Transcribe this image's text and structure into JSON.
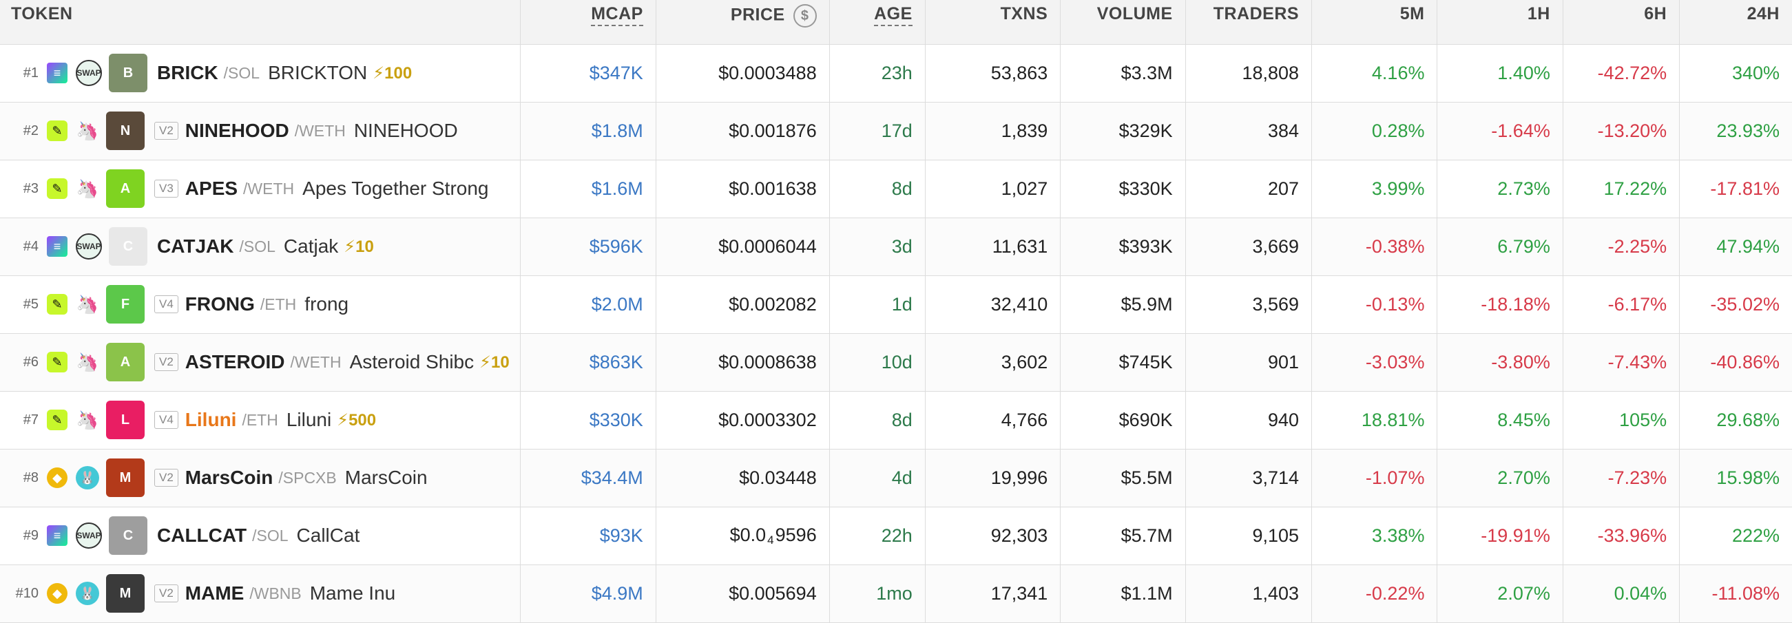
{
  "header": {
    "token": "TOKEN",
    "mcap": "MCAP",
    "price": "PRICE",
    "price_icon": "$",
    "age": "AGE",
    "txns": "TXNS",
    "volume": "VOLUME",
    "traders": "TRADERS",
    "m5": "5M",
    "h1": "1H",
    "h6": "6H",
    "h24": "24H"
  },
  "colors": {
    "positive": "#2ea043",
    "negative": "#d73a49",
    "mcap_blue": "#3b78c4",
    "age_green": "#2d7a4b",
    "boost_gold": "#c9a010"
  },
  "rows": [
    {
      "rank": "#1",
      "chain_icon": "solana-icon",
      "chain_glyph": "≡",
      "dex_icon": "raydium-swap-icon",
      "dex_glyph": "SWAP",
      "avatar_icon": "brick-avatar",
      "avatar_color": "#7d8f6a",
      "avatar_glyph": "B",
      "version": "",
      "symbol": "BRICK",
      "pair": "/SOL",
      "name": "BRICKTON",
      "boost": "⚡100",
      "mcap": "$347K",
      "price": "$0.0003488",
      "age": "23h",
      "txns": "53,863",
      "volume": "$3.3M",
      "traders": "18,808",
      "m5": "4.16%",
      "h1": "1.40%",
      "h6": "-42.72%",
      "h24": "340%"
    },
    {
      "rank": "#2",
      "chain_icon": "base-icon",
      "chain_glyph": "✎",
      "dex_icon": "uniswap-icon",
      "dex_glyph": "🦄",
      "avatar_icon": "ninehood-avatar",
      "avatar_color": "#5a4a3a",
      "avatar_glyph": "N",
      "version": "V2",
      "symbol": "NINEHOOD",
      "pair": "/WETH",
      "name": "NINEHOOD",
      "boost": "",
      "mcap": "$1.8M",
      "price": "$0.001876",
      "age": "17d",
      "txns": "1,839",
      "volume": "$329K",
      "traders": "384",
      "m5": "0.28%",
      "h1": "-1.64%",
      "h6": "-13.20%",
      "h24": "23.93%"
    },
    {
      "rank": "#3",
      "chain_icon": "base-icon",
      "chain_glyph": "✎",
      "dex_icon": "uniswap-icon",
      "dex_glyph": "🦄",
      "avatar_icon": "apes-avatar",
      "avatar_color": "#7fd321",
      "avatar_glyph": "A",
      "version": "V3",
      "symbol": "APES",
      "pair": "/WETH",
      "name": "Apes Together Strong",
      "boost": "",
      "mcap": "$1.6M",
      "price": "$0.001638",
      "age": "8d",
      "txns": "1,027",
      "volume": "$330K",
      "traders": "207",
      "m5": "3.99%",
      "h1": "2.73%",
      "h6": "17.22%",
      "h24": "-17.81%"
    },
    {
      "rank": "#4",
      "chain_icon": "solana-icon",
      "chain_glyph": "≡",
      "dex_icon": "raydium-swap-icon",
      "dex_glyph": "SWAP",
      "avatar_icon": "catjak-avatar",
      "avatar_color": "#e8e8e8",
      "avatar_glyph": "C",
      "version": "",
      "symbol": "CATJAK",
      "pair": "/SOL",
      "name": "Catjak",
      "boost": "⚡10",
      "mcap": "$596K",
      "price": "$0.0006044",
      "age": "3d",
      "txns": "11,631",
      "volume": "$393K",
      "traders": "3,669",
      "m5": "-0.38%",
      "h1": "6.79%",
      "h6": "-2.25%",
      "h24": "47.94%"
    },
    {
      "rank": "#5",
      "chain_icon": "base-icon",
      "chain_glyph": "✎",
      "dex_icon": "uniswap-icon",
      "dex_glyph": "🦄",
      "avatar_icon": "frong-avatar",
      "avatar_color": "#5cc84a",
      "avatar_glyph": "F",
      "version": "V4",
      "symbol": "FRONG",
      "pair": "/ETH",
      "name": "frong",
      "boost": "",
      "mcap": "$2.0M",
      "price": "$0.002082",
      "age": "1d",
      "txns": "32,410",
      "volume": "$5.9M",
      "traders": "3,569",
      "m5": "-0.13%",
      "h1": "-18.18%",
      "h6": "-6.17%",
      "h24": "-35.02%"
    },
    {
      "rank": "#6",
      "chain_icon": "base-icon",
      "chain_glyph": "✎",
      "dex_icon": "uniswap-icon",
      "dex_glyph": "🦄",
      "avatar_icon": "asteroid-avatar",
      "avatar_color": "#8bc34a",
      "avatar_glyph": "A",
      "version": "V2",
      "symbol": "ASTEROID",
      "pair": "/WETH",
      "name": "Asteroid Shibc",
      "boost": "⚡10",
      "mcap": "$863K",
      "price": "$0.0008638",
      "age": "10d",
      "txns": "3,602",
      "volume": "$745K",
      "traders": "901",
      "m5": "-3.03%",
      "h1": "-3.80%",
      "h6": "-7.43%",
      "h24": "-40.86%"
    },
    {
      "rank": "#7",
      "chain_icon": "base-icon",
      "chain_glyph": "✎",
      "dex_icon": "uniswap-icon",
      "dex_glyph": "🦄",
      "avatar_icon": "liluni-avatar",
      "avatar_color": "#e91e63",
      "avatar_glyph": "L",
      "version": "V4",
      "symbol": "Liluni",
      "pair": "/ETH",
      "name": "Liluni",
      "boost": "⚡500",
      "mcap": "$330K",
      "price": "$0.0003302",
      "age": "8d",
      "txns": "4,766",
      "volume": "$690K",
      "traders": "940",
      "m5": "18.81%",
      "h1": "8.45%",
      "h6": "105%",
      "h24": "29.68%"
    },
    {
      "rank": "#8",
      "chain_icon": "bnb-icon",
      "chain_glyph": "◆",
      "dex_icon": "pancakeswap-icon",
      "dex_glyph": "🐰",
      "avatar_icon": "marscoin-avatar",
      "avatar_color": "#b33a1a",
      "avatar_glyph": "M",
      "version": "V2",
      "symbol": "MarsCoin",
      "pair": "/SPCXB",
      "name": "MarsCoin",
      "boost": "",
      "mcap": "$34.4M",
      "price": "$0.03448",
      "age": "4d",
      "txns": "19,996",
      "volume": "$5.5M",
      "traders": "3,714",
      "m5": "-1.07%",
      "h1": "2.70%",
      "h6": "-7.23%",
      "h24": "15.98%"
    },
    {
      "rank": "#9",
      "chain_icon": "solana-icon",
      "chain_glyph": "≡",
      "dex_icon": "raydium-swap-icon",
      "dex_glyph": "SWAP",
      "avatar_icon": "callcat-avatar",
      "avatar_color": "#9e9e9e",
      "avatar_glyph": "C",
      "version": "",
      "symbol": "CALLCAT",
      "pair": "/SOL",
      "name": "CallCat",
      "boost": "",
      "mcap": "$93K",
      "price_pre": "$0.0",
      "price_sub": "4",
      "price_post": "9596",
      "age": "22h",
      "txns": "92,303",
      "volume": "$5.7M",
      "traders": "9,105",
      "m5": "3.38%",
      "h1": "-19.91%",
      "h6": "-33.96%",
      "h24": "222%"
    },
    {
      "rank": "#10",
      "chain_icon": "bnb-icon",
      "chain_glyph": "◆",
      "dex_icon": "pancakeswap-icon",
      "dex_glyph": "🐰",
      "avatar_icon": "mame-avatar",
      "avatar_color": "#3a3a3a",
      "avatar_glyph": "M",
      "version": "V2",
      "symbol": "MAME",
      "pair": "/WBNB",
      "name": "Mame Inu",
      "boost": "",
      "mcap": "$4.9M",
      "price": "$0.005694",
      "age": "1mo",
      "txns": "17,341",
      "volume": "$1.1M",
      "traders": "1,403",
      "m5": "-0.22%",
      "h1": "2.07%",
      "h6": "0.04%",
      "h24": "-11.08%"
    }
  ]
}
